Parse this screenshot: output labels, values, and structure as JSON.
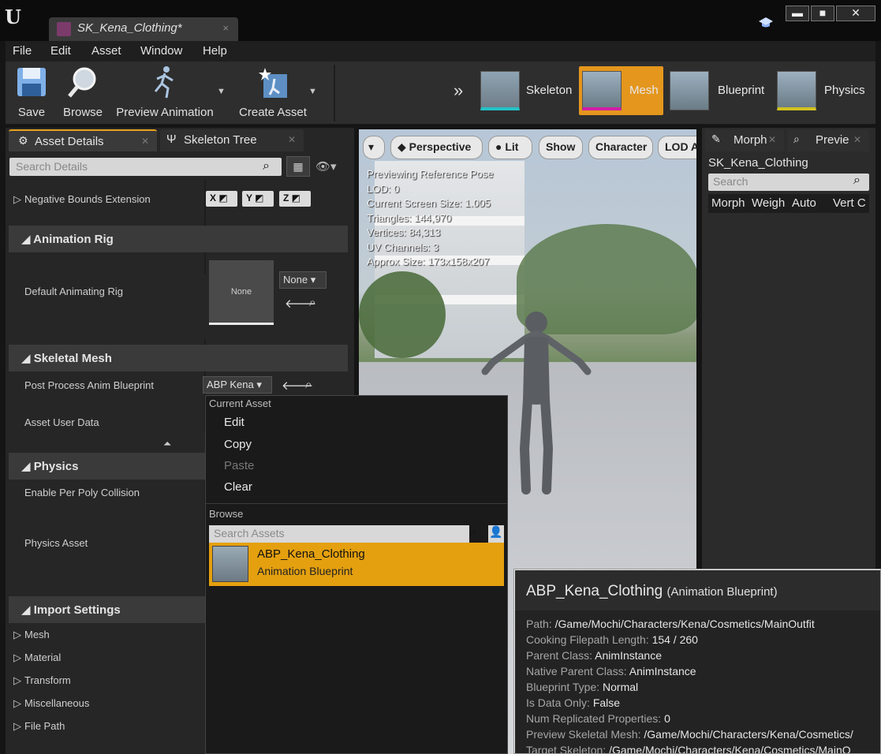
{
  "window": {
    "doc_tab_label": "SK_Kena_Clothing*",
    "doc_tab_close": "×",
    "min_label": "▬",
    "max_label": "■",
    "close_label": "✕"
  },
  "menu": [
    "File",
    "Edit",
    "Asset",
    "Window",
    "Help"
  ],
  "toolbar": {
    "save": "Save",
    "browse": "Browse",
    "preview_animation": "Preview Animation",
    "create_asset": "Create Asset"
  },
  "modes": {
    "skeleton": "Skeleton",
    "mesh": "Mesh",
    "blueprint": "Blueprint",
    "physics": "Physics",
    "active": "mesh",
    "active_color": "#e4961d"
  },
  "left_panel": {
    "tab_asset_details": "Asset Details",
    "tab_skeleton_tree": "Skeleton Tree",
    "search_placeholder": "Search Details",
    "negative_bounds_label": "Negative Bounds Extension",
    "xyz": [
      "X",
      "Y",
      "Z"
    ],
    "section_animation_rig": "Animation Rig",
    "default_animating_rig_label": "Default Animating Rig",
    "rig_thumb_text": "None",
    "rig_combo_value": "None",
    "section_skeletal_mesh": "Skeletal Mesh",
    "post_process_label": "Post Process Anim Blueprint",
    "post_process_value": "ABP Kena",
    "asset_user_data_label": "Asset User Data",
    "section_physics": "Physics",
    "per_poly_label": "Enable Per Poly Collision",
    "physics_asset_label": "Physics Asset",
    "section_import_settings": "Import Settings",
    "import_items": [
      "Mesh",
      "Material",
      "Transform",
      "Miscellaneous",
      "File Path"
    ]
  },
  "viewport": {
    "btn_perspective": "Perspective",
    "btn_lit": "Lit",
    "btn_show": "Show",
    "btn_character": "Character",
    "btn_lod": "LOD Au",
    "stats": [
      "Previewing Reference Pose",
      "LOD: 0",
      "Current Screen Size: 1.005",
      "Triangles: 144,970",
      "Vertices: 84,313",
      "UV Channels: 3",
      "Approx Size: 173x158x207"
    ]
  },
  "right_panel": {
    "tab_morph": "Morph",
    "tab_preview": "Previe",
    "title": "SK_Kena_Clothing",
    "search_placeholder": "Search",
    "columns": [
      "Morph",
      "Weigh",
      "Auto",
      "Vert C"
    ]
  },
  "dropdown": {
    "section_current_asset": "Current Asset",
    "edit": "Edit",
    "copy": "Copy",
    "paste": "Paste",
    "clear": "Clear",
    "section_browse": "Browse",
    "search_placeholder": "Search Assets",
    "asset_name": "ABP_Kena_Clothing",
    "asset_type": "Animation Blueprint",
    "highlight_color": "#e4a00f"
  },
  "tooltip": {
    "title": "ABP_Kena_Clothing",
    "subtitle": "(Animation Blueprint)",
    "rows": [
      {
        "key": "Path:",
        "value": "/Game/Mochi/Characters/Kena/Cosmetics/MainOutfit"
      },
      {
        "key": "Cooking Filepath Length:",
        "value": "154 / 260"
      },
      {
        "key": "Parent Class:",
        "value": "AnimInstance"
      },
      {
        "key": "Native Parent Class:",
        "value": "AnimInstance"
      },
      {
        "key": "Blueprint Type:",
        "value": "Normal"
      },
      {
        "key": "Is Data Only:",
        "value": "False"
      },
      {
        "key": "Num Replicated Properties:",
        "value": "0"
      },
      {
        "key": "Preview Skeletal Mesh:",
        "value": "/Game/Mochi/Characters/Kena/Cosmetics/"
      },
      {
        "key": "Target Skeleton:",
        "value": "/Game/Mochi/Characters/Kena/Cosmetics/MainO"
      }
    ]
  }
}
